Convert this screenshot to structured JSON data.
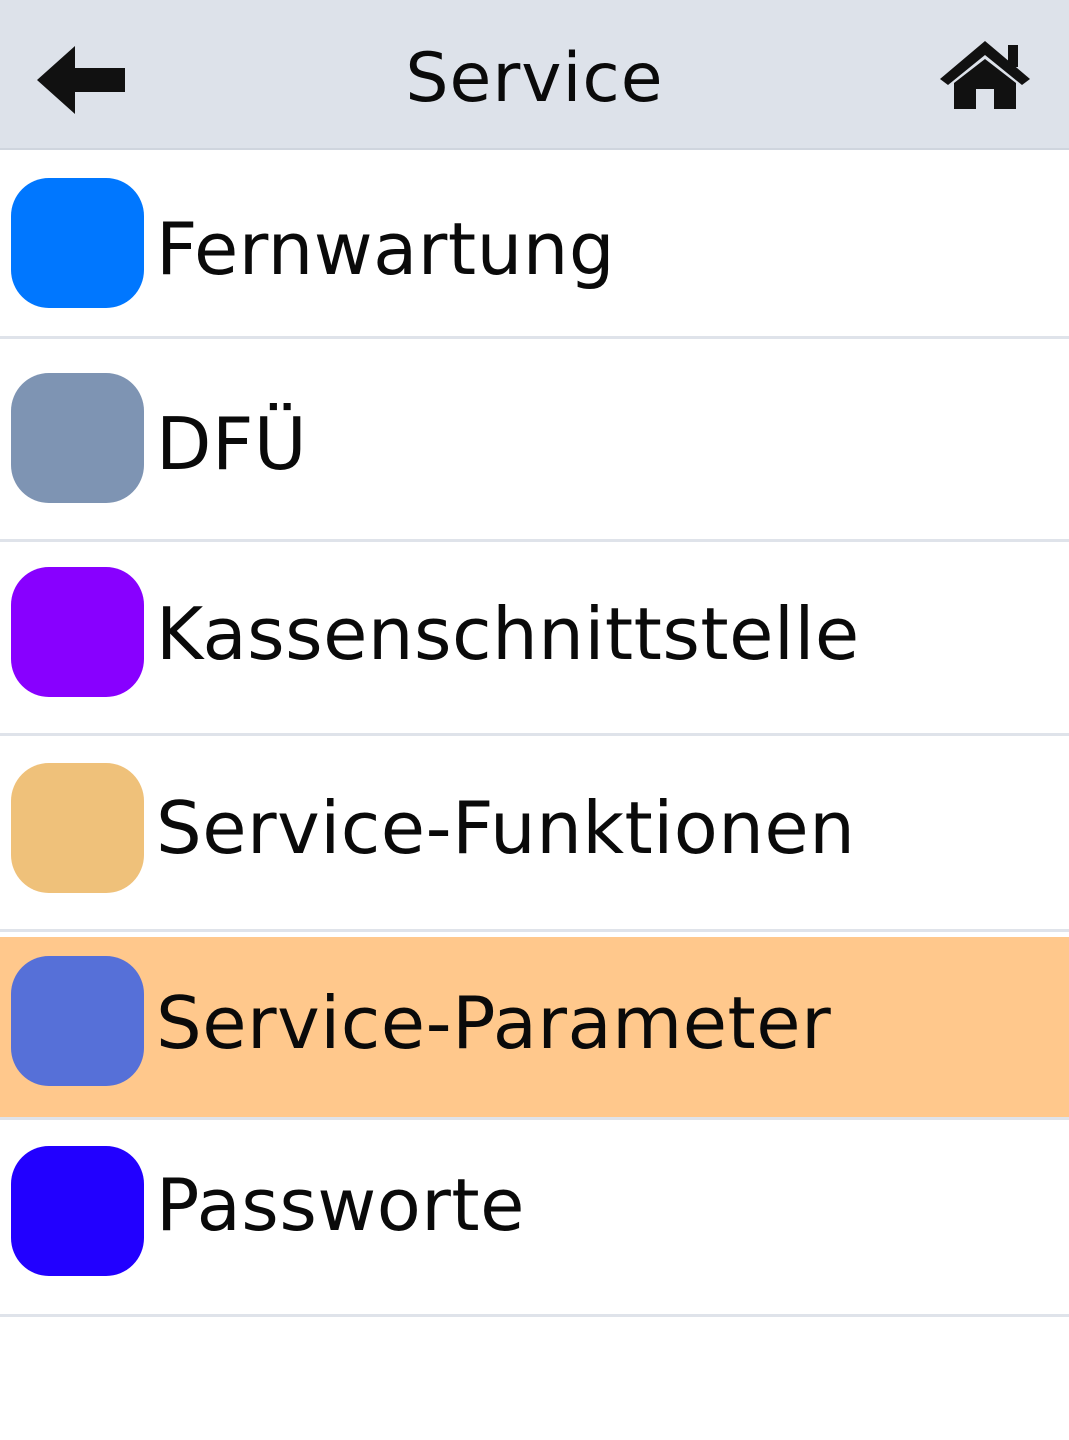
{
  "header": {
    "title": "Service",
    "back_icon": "arrow-left-icon",
    "home_icon": "home-icon"
  },
  "menu": {
    "items": [
      {
        "label": "Fernwartung",
        "color": "#0077ff",
        "selected": false
      },
      {
        "label": "DFÜ",
        "color": "#7e94b3",
        "selected": false
      },
      {
        "label": "Kassenschnittstelle",
        "color": "#8800ff",
        "selected": false
      },
      {
        "label": "Service-Funktionen",
        "color": "#efc17a",
        "selected": false
      },
      {
        "label": "Service-Parameter",
        "color": "#5670d8",
        "selected": true
      },
      {
        "label": "Passworte",
        "color": "#2200ff",
        "selected": false
      }
    ]
  },
  "colors": {
    "header_bg": "#dde2ea",
    "selected_row_bg": "#ffc88c",
    "divider": "#dfe3ea"
  }
}
